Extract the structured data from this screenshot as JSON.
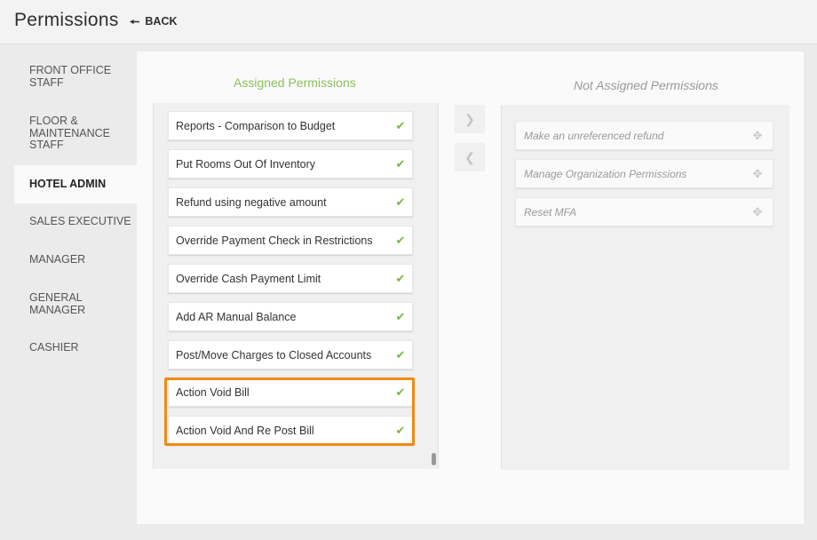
{
  "header": {
    "title": "Permissions",
    "back_label": "BACK"
  },
  "sidebar": {
    "items": [
      {
        "label": "FRONT OFFICE STAFF",
        "active": false
      },
      {
        "label": "FLOOR & MAINTENANCE STAFF",
        "active": false
      },
      {
        "label": "HOTEL ADMIN",
        "active": true
      },
      {
        "label": "SALES EXECUTIVE",
        "active": false
      },
      {
        "label": "MANAGER",
        "active": false
      },
      {
        "label": "GENERAL MANAGER",
        "active": false
      },
      {
        "label": "CASHIER",
        "active": false
      }
    ]
  },
  "assigned": {
    "title": "Assigned Permissions",
    "items": [
      {
        "label": "Reports - Comparison to Budget"
      },
      {
        "label": "Put Rooms Out Of Inventory"
      },
      {
        "label": "Refund using negative amount"
      },
      {
        "label": "Override Payment Check in Restrictions"
      },
      {
        "label": "Override Cash Payment Limit"
      },
      {
        "label": "Add AR Manual Balance"
      },
      {
        "label": "Post/Move Charges to Closed Accounts"
      },
      {
        "label": "Action Void Bill"
      },
      {
        "label": "Action Void And Re Post Bill"
      }
    ]
  },
  "not_assigned": {
    "title": "Not Assigned Permissions",
    "items": [
      {
        "label": "Make an unreferenced refund"
      },
      {
        "label": "Manage Organization Permissions"
      },
      {
        "label": "Reset MFA"
      }
    ]
  },
  "icons": {
    "back": "arrow-left-icon",
    "check": "check-icon",
    "drag": "drag-handle-icon",
    "move_right": "chevron-right-icon",
    "move_left": "chevron-left-icon"
  },
  "colors": {
    "assigned_title": "#8bbf5a",
    "check": "#7cb342",
    "highlight": "#f28a12"
  }
}
